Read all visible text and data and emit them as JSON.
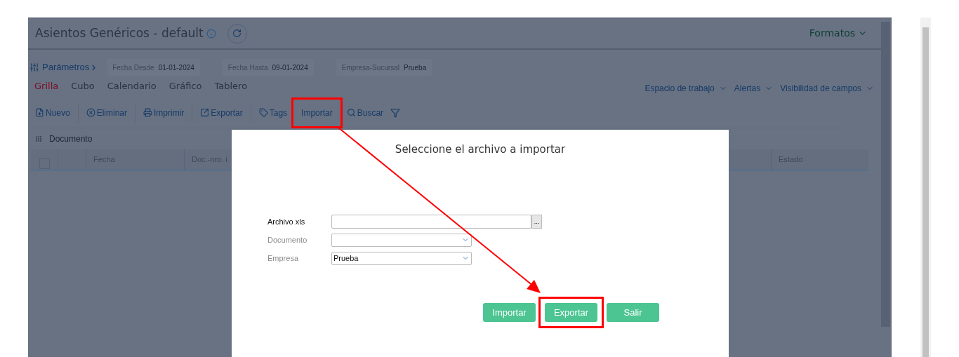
{
  "page": {
    "title": "Asientos Genéricos - default",
    "formats": "Formatos"
  },
  "parameters": {
    "label": "Parámetros",
    "fields": [
      {
        "label": "Fecha Desde",
        "value": "01-01-2024"
      },
      {
        "label": "Fecha Hasta",
        "value": "09-01-2024"
      },
      {
        "label": "Empresa-Sucursal",
        "value": "Prueba"
      }
    ]
  },
  "views": [
    {
      "label": "Grilla",
      "selected": true
    },
    {
      "label": "Cubo",
      "selected": false
    },
    {
      "label": "Calendario",
      "selected": false
    },
    {
      "label": "Gráfico",
      "selected": false
    },
    {
      "label": "Tablero",
      "selected": false
    }
  ],
  "view_menus": [
    "Espacio de trabajo",
    "Alertas",
    "Visibilidad de campos"
  ],
  "toolbar": [
    {
      "label": "Nuevo",
      "highlighted": false
    },
    {
      "label": "Eliminar",
      "highlighted": false
    },
    {
      "label": "Imprimir",
      "highlighted": false
    },
    {
      "label": "Exportar",
      "highlighted": false
    },
    {
      "label": "Tags",
      "highlighted": false
    },
    {
      "label": "Importar",
      "highlighted": true
    },
    {
      "label": "Buscar",
      "highlighted": false
    }
  ],
  "grid": {
    "group": "Documento",
    "select_all_checked": false,
    "columns": [
      "Fecha",
      "Doc.-nro. i",
      "Estado"
    ]
  },
  "dialog": {
    "title": "Seleccione el archivo a importar",
    "fields": [
      {
        "label": "Archivo xls",
        "kind": "file",
        "disabled": false,
        "browse": "..."
      },
      {
        "label": "Documento",
        "kind": "select",
        "disabled": true
      },
      {
        "label": "Empresa",
        "kind": "select",
        "disabled": true,
        "value": "Prueba"
      }
    ],
    "buttons": [
      {
        "label": "Importar",
        "highlighted": false
      },
      {
        "label": "Exportar",
        "highlighted": true
      },
      {
        "label": "Salir",
        "highlighted": false
      }
    ]
  }
}
